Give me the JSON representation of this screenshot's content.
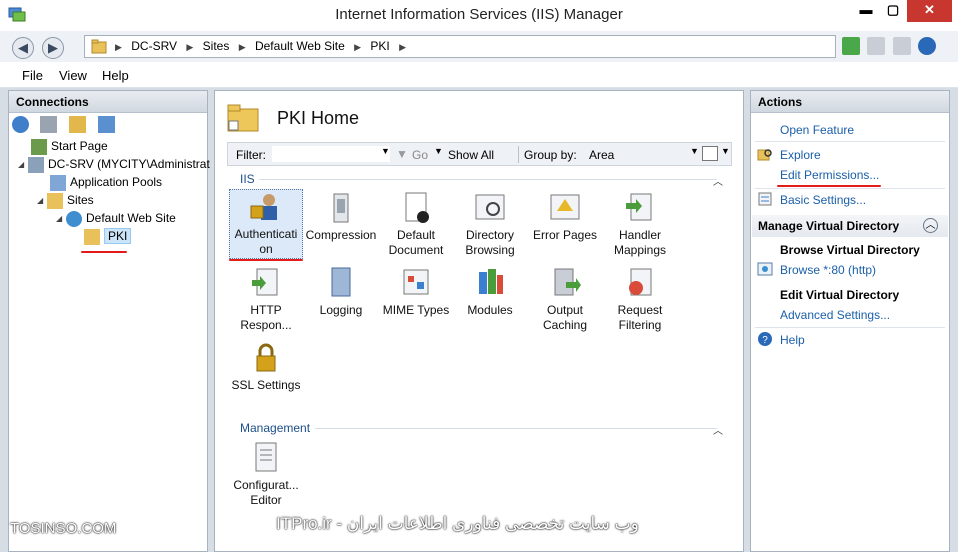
{
  "window": {
    "title": "Internet Information Services (IIS) Manager"
  },
  "address": {
    "crumbs": [
      "DC-SRV",
      "Sites",
      "Default Web Site",
      "PKI"
    ]
  },
  "menu": {
    "file": "File",
    "view": "View",
    "help": "Help"
  },
  "connections": {
    "header": "Connections",
    "tree": [
      {
        "label": "Start Page"
      },
      {
        "label": "DC-SRV (MYCITY\\Administrat"
      },
      {
        "label": "Application Pools"
      },
      {
        "label": "Sites"
      },
      {
        "label": "Default Web Site"
      },
      {
        "label": "PKI"
      }
    ]
  },
  "main": {
    "title": "PKI Home",
    "filter": {
      "label": "Filter:",
      "go": "Go",
      "show_all": "Show All",
      "group_by": "Group by:",
      "group_value": "Area"
    },
    "iis_section": "IIS",
    "management_section": "Management",
    "features": [
      {
        "line1": "Authenticati",
        "line2": "on"
      },
      {
        "line1": "Compression",
        "line2": ""
      },
      {
        "line1": "Default",
        "line2": "Document"
      },
      {
        "line1": "Directory",
        "line2": "Browsing"
      },
      {
        "line1": "Error Pages",
        "line2": ""
      },
      {
        "line1": "Handler",
        "line2": "Mappings"
      },
      {
        "line1": "HTTP",
        "line2": "Respon..."
      },
      {
        "line1": "Logging",
        "line2": ""
      },
      {
        "line1": "MIME Types",
        "line2": ""
      },
      {
        "line1": "Modules",
        "line2": ""
      },
      {
        "line1": "Output",
        "line2": "Caching"
      },
      {
        "line1": "Request",
        "line2": "Filtering"
      },
      {
        "line1": "SSL Settings",
        "line2": ""
      },
      {
        "line1": "Configurat...",
        "line2": "Editor"
      }
    ]
  },
  "actions": {
    "header": "Actions",
    "open_feature": "Open Feature",
    "explore": "Explore",
    "edit_permissions": "Edit Permissions...",
    "basic_settings": "Basic Settings...",
    "manage_vd": "Manage Virtual Directory",
    "browse_vd": "Browse Virtual Directory",
    "browse_80": "Browse *:80 (http)",
    "edit_vd": "Edit Virtual Directory",
    "advanced_settings": "Advanced Settings...",
    "help": "Help"
  },
  "watermarks": {
    "left": "TOSINSO.COM",
    "center": "ITPro.ir - وب سایت تخصصی فناوری اطلاعات ایران"
  }
}
